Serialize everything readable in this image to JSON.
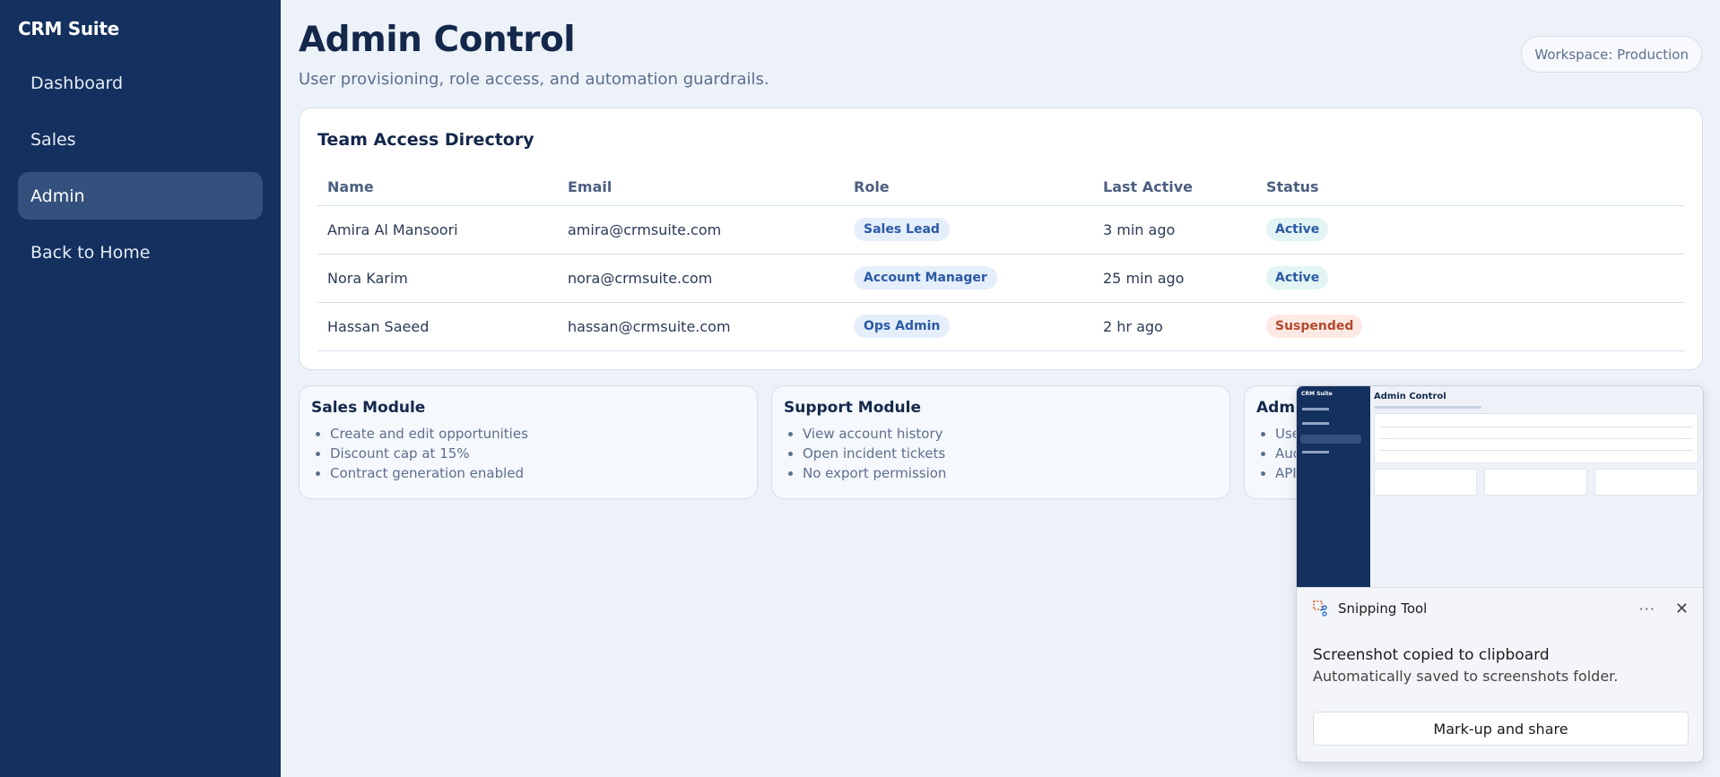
{
  "sidebar": {
    "brand": "CRM Suite",
    "items": [
      {
        "label": "Dashboard",
        "active": false
      },
      {
        "label": "Sales",
        "active": false
      },
      {
        "label": "Admin",
        "active": true
      },
      {
        "label": "Back to Home",
        "active": false
      }
    ]
  },
  "header": {
    "title": "Admin Control",
    "subtitle": "User provisioning, role access, and automation guardrails.",
    "workspace": "Workspace: Production"
  },
  "directory": {
    "title": "Team Access Directory",
    "columns": [
      "Name",
      "Email",
      "Role",
      "Last Active",
      "Status"
    ],
    "rows": [
      {
        "name": "Amira Al Mansoori",
        "email": "amira@crmsuite.com",
        "role": "Sales Lead",
        "last_active": "3 min ago",
        "status": "Active"
      },
      {
        "name": "Nora Karim",
        "email": "nora@crmsuite.com",
        "role": "Account Manager",
        "last_active": "25 min ago",
        "status": "Active"
      },
      {
        "name": "Hassan Saeed",
        "email": "hassan@crmsuite.com",
        "role": "Ops Admin",
        "last_active": "2 hr ago",
        "status": "Suspended"
      }
    ]
  },
  "modules": [
    {
      "title": "Sales Module",
      "items": [
        "Create and edit opportunities",
        "Discount cap at 15%",
        "Contract generation enabled"
      ]
    },
    {
      "title": "Support Module",
      "items": [
        "View account history",
        "Open incident tickets",
        "No export permission"
      ]
    },
    {
      "title": "Admi",
      "items": [
        "Use",
        "Aud",
        "API"
      ]
    }
  ],
  "toast": {
    "app_name": "Snipping Tool",
    "message": "Screenshot copied to clipboard",
    "submessage": "Automatically saved to screenshots folder.",
    "action": "Mark-up and share",
    "more_glyph": "···",
    "close_glyph": "✕",
    "thumbnail_title": "Admin Control",
    "thumbnail_brand": "CRM Suite"
  },
  "colors": {
    "sidebar_bg": "#13305e",
    "page_bg": "#edf2f9",
    "accent": "#2b5aa5",
    "active_bg": "#e2f4f4",
    "suspended_bg": "#fde9e4",
    "suspended_text": "#b24a2e"
  }
}
